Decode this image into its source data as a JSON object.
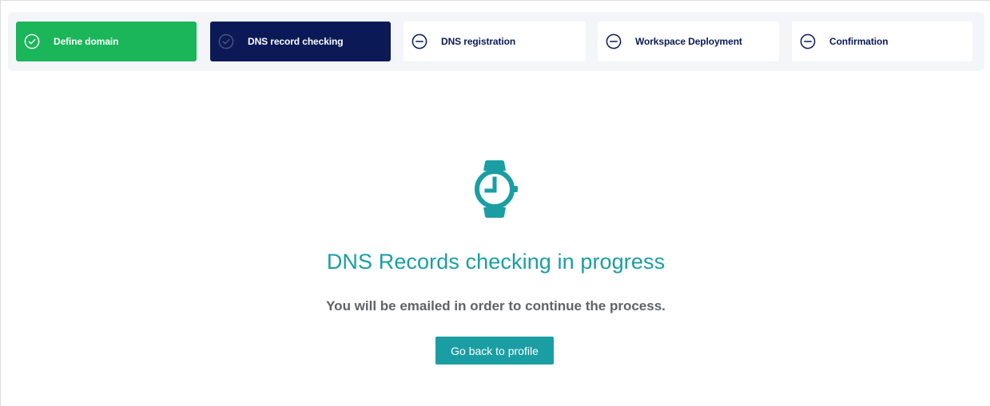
{
  "stepper": {
    "steps": [
      {
        "label": "Define domain",
        "status": "completed",
        "icon": "check-circle-icon"
      },
      {
        "label": "DNS record checking",
        "status": "active",
        "icon": "check-circle-icon"
      },
      {
        "label": "DNS registration",
        "status": "pending",
        "icon": "minus-circle-icon"
      },
      {
        "label": "Workspace Deployment",
        "status": "pending",
        "icon": "minus-circle-icon"
      },
      {
        "label": "Confirmation",
        "status": "pending",
        "icon": "minus-circle-icon"
      }
    ]
  },
  "main": {
    "icon": "watch-icon",
    "title": "DNS Records checking in progress",
    "subtitle": "You will be emailed in order to continue the process.",
    "button_label": "Go back to profile"
  },
  "colors": {
    "completed": "#1bb55a",
    "active": "#0b1a57",
    "accent": "#1a9ea3",
    "text_muted": "#5f6268"
  }
}
